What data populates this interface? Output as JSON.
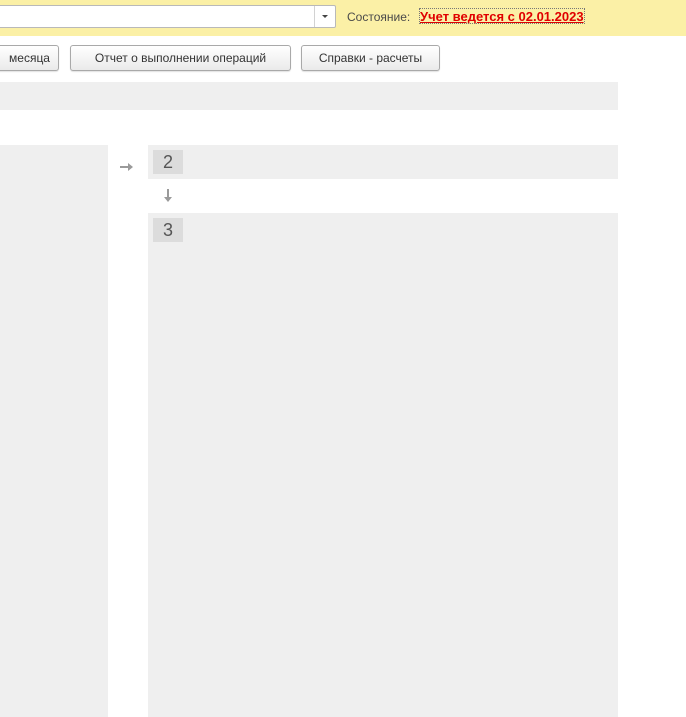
{
  "header": {
    "status_label": "Состояние:",
    "status_value": "Учет ведется с 02.01.2023",
    "status_color": "#e00000",
    "panel_color": "#fbf0a6",
    "org_select": {
      "value": "",
      "icon": "dropdown-triangle"
    }
  },
  "toolbar": {
    "month_button_label": "месяца",
    "report_button_label": "Отчет о выполнении операций",
    "calculations_button_label": "Справки - расчеты"
  },
  "workflow": {
    "steps": [
      {
        "number": "2"
      },
      {
        "number": "3"
      }
    ],
    "arrows": [
      "arrow-right-icon",
      "arrow-down-icon"
    ]
  }
}
